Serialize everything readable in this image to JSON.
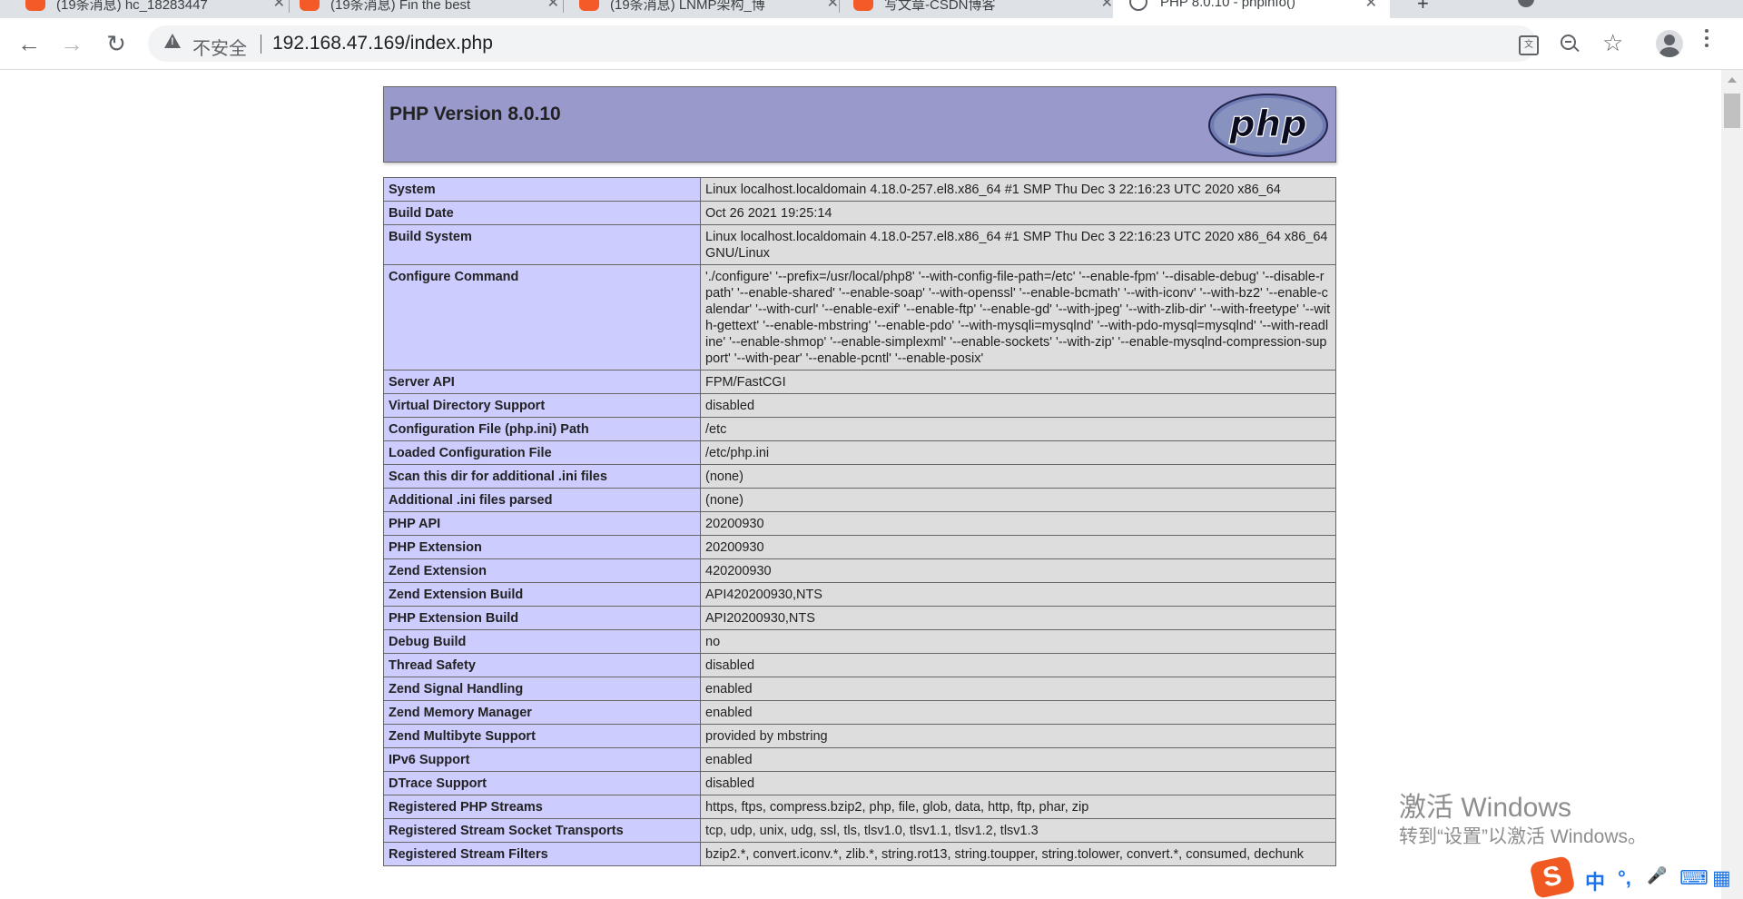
{
  "browser": {
    "tabs": [
      {
        "title": "(19条消息) hc_18283447",
        "close": "✕"
      },
      {
        "title": "(19条消息) Fin the best",
        "close": "✕"
      },
      {
        "title": "(19条消息) LNMP架构_博",
        "close": "✕"
      },
      {
        "title": "写文章-CSDN博客",
        "close": "✕"
      },
      {
        "title": "PHP 8.0.10 - phpinfo()",
        "close": "✕"
      }
    ],
    "new_tab": "+",
    "security_label": "不安全",
    "url": "192.168.47.169/index.php"
  },
  "page": {
    "title": "PHP Version 8.0.10",
    "logo_text": "php",
    "rows": [
      {
        "key": "System",
        "value": "Linux localhost.localdomain 4.18.0-257.el8.x86_64 #1 SMP Thu Dec 3 22:16:23 UTC 2020 x86_64"
      },
      {
        "key": "Build Date",
        "value": "Oct 26 2021 19:25:14"
      },
      {
        "key": "Build System",
        "value": "Linux localhost.localdomain 4.18.0-257.el8.x86_64 #1 SMP Thu Dec 3 22:16:23 UTC 2020 x86_64 x86_64 GNU/Linux"
      },
      {
        "key": "Configure Command",
        "value": "'./configure' '--prefix=/usr/local/php8' '--with-config-file-path=/etc' '--enable-fpm' '--disable-debug' '--disable-rpath' '--enable-shared' '--enable-soap' '--with-openssl' '--enable-bcmath' '--with-iconv' '--with-bz2' '--enable-calendar' '--with-curl' '--enable-exif' '--enable-ftp' '--enable-gd' '--with-jpeg' '--with-zlib-dir' '--with-freetype' '--with-gettext' '--enable-mbstring' '--enable-pdo' '--with-mysqli=mysqlnd' '--with-pdo-mysql=mysqlnd' '--with-readline' '--enable-shmop' '--enable-simplexml' '--enable-sockets' '--with-zip' '--enable-mysqlnd-compression-support' '--with-pear' '--enable-pcntl' '--enable-posix'"
      },
      {
        "key": "Server API",
        "value": "FPM/FastCGI"
      },
      {
        "key": "Virtual Directory Support",
        "value": "disabled"
      },
      {
        "key": "Configuration File (php.ini) Path",
        "value": "/etc"
      },
      {
        "key": "Loaded Configuration File",
        "value": "/etc/php.ini"
      },
      {
        "key": "Scan this dir for additional .ini files",
        "value": "(none)"
      },
      {
        "key": "Additional .ini files parsed",
        "value": "(none)"
      },
      {
        "key": "PHP API",
        "value": "20200930"
      },
      {
        "key": "PHP Extension",
        "value": "20200930"
      },
      {
        "key": "Zend Extension",
        "value": "420200930"
      },
      {
        "key": "Zend Extension Build",
        "value": "API420200930,NTS"
      },
      {
        "key": "PHP Extension Build",
        "value": "API20200930,NTS"
      },
      {
        "key": "Debug Build",
        "value": "no"
      },
      {
        "key": "Thread Safety",
        "value": "disabled"
      },
      {
        "key": "Zend Signal Handling",
        "value": "enabled"
      },
      {
        "key": "Zend Memory Manager",
        "value": "enabled"
      },
      {
        "key": "Zend Multibyte Support",
        "value": "provided by mbstring"
      },
      {
        "key": "IPv6 Support",
        "value": "enabled"
      },
      {
        "key": "DTrace Support",
        "value": "disabled"
      },
      {
        "key": "Registered PHP Streams",
        "value": "https, ftps, compress.bzip2, php, file, glob, data, http, ftp, phar, zip"
      },
      {
        "key": "Registered Stream Socket Transports",
        "value": "tcp, udp, unix, udg, ssl, tls, tlsv1.0, tlsv1.1, tlsv1.2, tlsv1.3"
      },
      {
        "key": "Registered Stream Filters",
        "value": "bzip2.*, convert.iconv.*, zlib.*, string.rot13, string.toupper, string.tolower, convert.*, consumed, dechunk"
      }
    ]
  },
  "overlay": {
    "activation_line1": "激活 Windows",
    "activation_line2": "转到“设置”以激活 Windows。",
    "ime_logo": "S",
    "ime_items": [
      "中",
      "°,",
      "🎤",
      "⌨",
      "▦"
    ]
  },
  "colors": {
    "header_bg": "#9999cc",
    "key_bg": "#ccccff",
    "value_bg": "#dddddd",
    "tab_favicon": "#f45a27"
  }
}
